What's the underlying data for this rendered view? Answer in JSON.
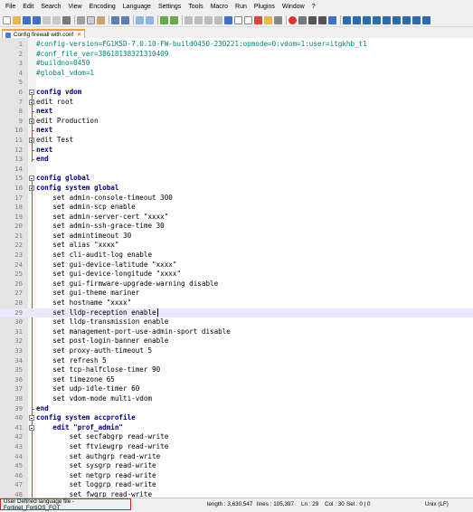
{
  "menu": [
    "File",
    "Edit",
    "Search",
    "View",
    "Encoding",
    "Language",
    "Settings",
    "Tools",
    "Macro",
    "Run",
    "Plugins",
    "Window",
    "?"
  ],
  "tab": {
    "label": "Config firewall with.conf"
  },
  "lines": [
    {
      "n": "1",
      "text": "#config-version=FG1K5D-7.0.10-FW-build0450-230221:opmode=0:vdom=1:user=itgkhb_t1",
      "cls": "comment"
    },
    {
      "n": "2",
      "text": "#conf_file_ver=38618138321310409",
      "cls": "comment"
    },
    {
      "n": "3",
      "text": "#buildno=0450",
      "cls": "comment"
    },
    {
      "n": "4",
      "text": "#global_vdom=1",
      "cls": "comment"
    },
    {
      "n": "5",
      "text": "",
      "cls": ""
    },
    {
      "n": "6",
      "text": "config vdom",
      "cls": "kw"
    },
    {
      "n": "7",
      "text": "edit root",
      "cls": ""
    },
    {
      "n": "8",
      "text": "next",
      "cls": "kw"
    },
    {
      "n": "9",
      "text": "edit Production",
      "cls": ""
    },
    {
      "n": "10",
      "text": "next",
      "cls": "kw"
    },
    {
      "n": "11",
      "text": "edit Test",
      "cls": ""
    },
    {
      "n": "12",
      "text": "next",
      "cls": "kw"
    },
    {
      "n": "13",
      "text": "end",
      "cls": "kw"
    },
    {
      "n": "14",
      "text": "",
      "cls": ""
    },
    {
      "n": "15",
      "text": "config global",
      "cls": "kw"
    },
    {
      "n": "16",
      "text": "config system global",
      "cls": "kw"
    },
    {
      "n": "17",
      "text": "    set admin-console-timeout 300",
      "cls": ""
    },
    {
      "n": "18",
      "text": "    set admin-scp enable",
      "cls": ""
    },
    {
      "n": "19",
      "text": "    set admin-server-cert \"xxxx\"",
      "cls": ""
    },
    {
      "n": "20",
      "text": "    set admin-ssh-grace-time 30",
      "cls": ""
    },
    {
      "n": "21",
      "text": "    set admintimeout 30",
      "cls": ""
    },
    {
      "n": "22",
      "text": "    set alias \"xxxx\"",
      "cls": ""
    },
    {
      "n": "23",
      "text": "    set cli-audit-log enable",
      "cls": ""
    },
    {
      "n": "24",
      "text": "    set gui-device-latitude \"xxxx\"",
      "cls": ""
    },
    {
      "n": "25",
      "text": "    set gui-device-longitude \"xxxx\"",
      "cls": ""
    },
    {
      "n": "26",
      "text": "    set gui-firmware-upgrade-warning disable",
      "cls": ""
    },
    {
      "n": "27",
      "text": "    set gui-theme mariner",
      "cls": ""
    },
    {
      "n": "28",
      "text": "    set hostname \"xxxx\"",
      "cls": ""
    },
    {
      "n": "29",
      "text": "    set lldp-reception enable",
      "cls": "",
      "current": true
    },
    {
      "n": "30",
      "text": "    set lldp-transmission enable",
      "cls": ""
    },
    {
      "n": "31",
      "text": "    set management-port-use-admin-sport disable",
      "cls": ""
    },
    {
      "n": "32",
      "text": "    set post-login-banner enable",
      "cls": ""
    },
    {
      "n": "33",
      "text": "    set proxy-auth-timeout 5",
      "cls": ""
    },
    {
      "n": "34",
      "text": "    set refresh 5",
      "cls": ""
    },
    {
      "n": "35",
      "text": "    set tcp-halfclose-timer 90",
      "cls": ""
    },
    {
      "n": "36",
      "text": "    set timezone 65",
      "cls": ""
    },
    {
      "n": "37",
      "text": "    set udp-idle-timer 60",
      "cls": ""
    },
    {
      "n": "38",
      "text": "    set vdom-mode multi-vdom",
      "cls": ""
    },
    {
      "n": "39",
      "text": "end",
      "cls": "kw"
    },
    {
      "n": "40",
      "text": "config system accprofile",
      "cls": "kw"
    },
    {
      "n": "41",
      "text": "    edit \"prof_admin\"",
      "cls": "kw"
    },
    {
      "n": "42",
      "text": "        set secfabgrp read-write",
      "cls": ""
    },
    {
      "n": "43",
      "text": "        set ftviewgrp read-write",
      "cls": ""
    },
    {
      "n": "44",
      "text": "        set authgrp read-write",
      "cls": ""
    },
    {
      "n": "45",
      "text": "        set sysgrp read-write",
      "cls": ""
    },
    {
      "n": "46",
      "text": "        set netgrp read-write",
      "cls": ""
    },
    {
      "n": "47",
      "text": "        set loggrp read-write",
      "cls": ""
    },
    {
      "n": "48",
      "text": "        set fwgrp read-write",
      "cls": ""
    }
  ],
  "status": {
    "language": "User Defined language file - Fortinet_FortiOS_FGT",
    "length": "length : 3,630,547",
    "lines": "lines : 105,397",
    "ln": "Ln : 29",
    "col": "Col : 30",
    "sel": "Sel : 0 | 0",
    "eol": "Unix (LF)"
  },
  "colors": {
    "comment": "#008080",
    "keyword": "#000080",
    "fold": "#d94040",
    "tab_accent": "#f7a12e"
  }
}
